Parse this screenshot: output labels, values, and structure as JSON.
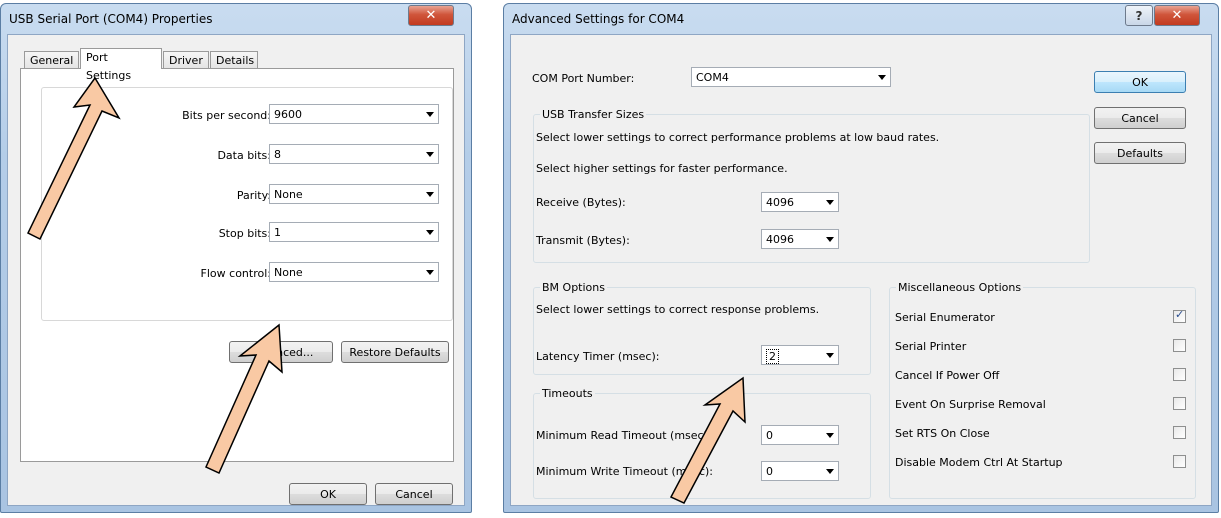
{
  "properties_dialog": {
    "title": "USB Serial Port (COM4) Properties",
    "close_glyph": "✕",
    "tabs": [
      "General",
      "Port Settings",
      "Driver",
      "Details"
    ],
    "fields": [
      {
        "label": "Bits per second:",
        "value": "9600"
      },
      {
        "label": "Data bits:",
        "value": "8"
      },
      {
        "label": "Parity:",
        "value": "None"
      },
      {
        "label": "Stop bits:",
        "value": "1"
      },
      {
        "label": "Flow control:",
        "value": "None"
      }
    ],
    "advanced_label": "Advanced...",
    "restore_label": "Restore Defaults",
    "ok_label": "OK",
    "cancel_label": "Cancel"
  },
  "advanced_dialog": {
    "title": "Advanced Settings for COM4",
    "help_glyph": "?",
    "close_glyph": "✕",
    "com_port_label": "COM Port Number:",
    "com_port_value": "COM4",
    "ok_label": "OK",
    "cancel_label": "Cancel",
    "defaults_label": "Defaults",
    "usb_transfer": {
      "title": "USB Transfer Sizes",
      "note1": "Select lower settings to correct performance problems at low baud rates.",
      "note2": "Select higher settings for faster performance.",
      "receive_label": "Receive (Bytes):",
      "receive_value": "4096",
      "transmit_label": "Transmit (Bytes):",
      "transmit_value": "4096"
    },
    "bm_options": {
      "title": "BM Options",
      "note": "Select lower settings to correct response problems.",
      "latency_label": "Latency Timer (msec):",
      "latency_value": "2"
    },
    "timeouts": {
      "title": "Timeouts",
      "read_label": "Minimum Read Timeout (msec):",
      "read_value": "0",
      "write_label": "Minimum Write Timeout (msec):",
      "write_value": "0"
    },
    "misc": {
      "title": "Miscellaneous Options",
      "options": [
        {
          "label": "Serial Enumerator",
          "checked": true
        },
        {
          "label": "Serial Printer",
          "checked": false
        },
        {
          "label": "Cancel If Power Off",
          "checked": false
        },
        {
          "label": "Event On Surprise Removal",
          "checked": false
        },
        {
          "label": "Set RTS On Close",
          "checked": false
        },
        {
          "label": "Disable Modem Ctrl At Startup",
          "checked": false
        }
      ]
    }
  },
  "colors": {
    "arrow_fill": "#f9c9a4",
    "arrow_stroke": "#000000",
    "dialog_face": "#f0f0f0",
    "title_glass": "#b4cde8"
  }
}
